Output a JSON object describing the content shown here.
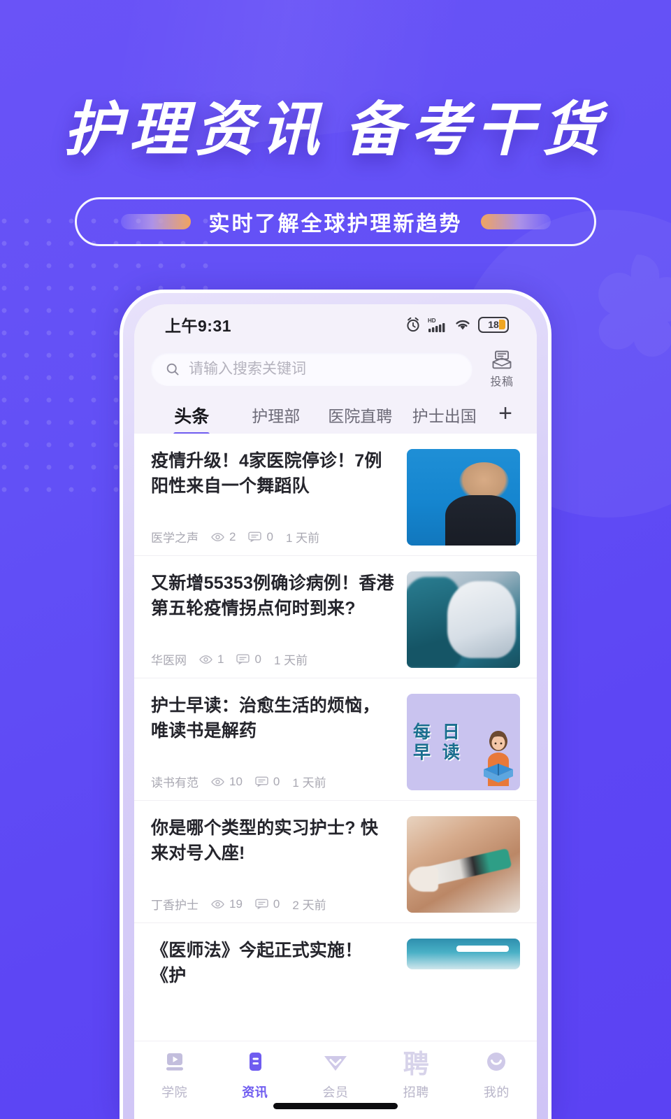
{
  "promo": {
    "title_part1": "护理资讯",
    "title_part2": "备考干货",
    "subtitle": "实时了解全球护理新趋势",
    "accent_purple": "#5b4ef5",
    "accent_orange": "#f0a460"
  },
  "phone": {
    "status": {
      "time": "上午9:31",
      "alarm_icon": "alarm-icon",
      "hd_label": "HD",
      "signal_icon": "signal-bars-icon",
      "wifi_icon": "wifi-icon",
      "battery_level": "18"
    },
    "search": {
      "icon": "search-icon",
      "placeholder": "请输入搜索关键词",
      "value": ""
    },
    "submit": {
      "icon": "mailbox-icon",
      "label": "投稿"
    },
    "tabs": [
      {
        "label": "头条",
        "active": true
      },
      {
        "label": "护理部",
        "active": false
      },
      {
        "label": "医院直聘",
        "active": false
      },
      {
        "label": "护士出国",
        "active": false
      }
    ],
    "tab_add_label": "+",
    "news": [
      {
        "title": "疫情升级！4家医院停诊！7例阳性来自一个舞蹈队",
        "source": "医学之声",
        "views": "2",
        "comments": "0",
        "time": "1 天前",
        "thumb": "press-conference-photo"
      },
      {
        "title": "又新增55353例确诊病例！香港第五轮疫情拐点何时到来?",
        "source": "华医网",
        "views": "1",
        "comments": "0",
        "time": "1 天前",
        "thumb": "nurse-gloves-photo"
      },
      {
        "title": "护士早读：治愈生活的烦恼，唯读书是解药",
        "source": "读书有范",
        "views": "10",
        "comments": "0",
        "time": "1 天前",
        "thumb": "daily-reading-card",
        "thumb_text_line1": "每 日",
        "thumb_text_line2": "早 读"
      },
      {
        "title": "你是哪个类型的实习护士? 快来对号入座!",
        "source": "丁香护士",
        "views": "19",
        "comments": "0",
        "time": "2 天前",
        "thumb": "syringe-photo"
      },
      {
        "title": "《医师法》今起正式实施！《护",
        "source": "",
        "views": "",
        "comments": "",
        "time": "",
        "thumb": "partial-photo"
      }
    ],
    "bottom_nav": [
      {
        "label": "学院",
        "icon": "video-play-icon",
        "active": false
      },
      {
        "label": "资讯",
        "icon": "document-icon",
        "active": true
      },
      {
        "label": "会员",
        "icon": "diamond-icon",
        "active": false
      },
      {
        "label": "招聘",
        "icon": "hire-char-icon",
        "active": false
      },
      {
        "label": "我的",
        "icon": "smiley-face-icon",
        "active": false
      }
    ],
    "nav_hire_char": "聘"
  }
}
